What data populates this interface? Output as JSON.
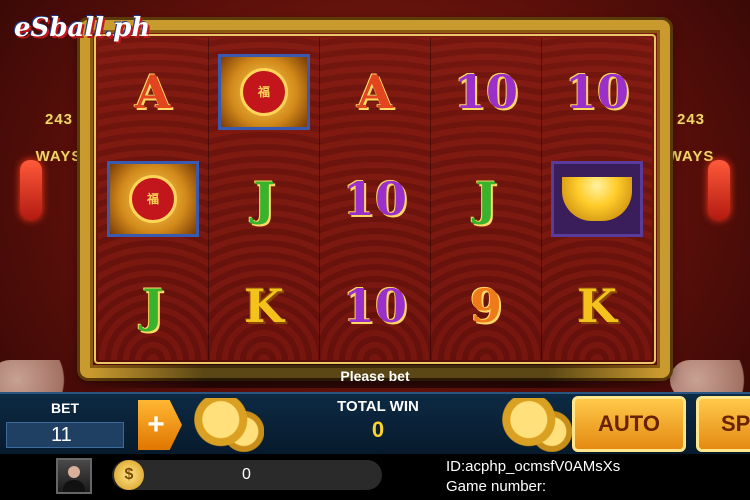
{
  "logo": {
    "text": "eSball.ph"
  },
  "side_banner": {
    "left_text": "243\nWAYS",
    "right_text": "243\nWAYS"
  },
  "reels": [
    [
      {
        "type": "text",
        "symbol": "A",
        "cls": "sym-A"
      },
      {
        "type": "fu",
        "symbol": "福"
      },
      {
        "type": "text",
        "symbol": "J",
        "cls": "sym-J"
      }
    ],
    [
      {
        "type": "fu",
        "symbol": "福"
      },
      {
        "type": "text",
        "symbol": "J",
        "cls": "sym-J"
      },
      {
        "type": "text",
        "symbol": "K",
        "cls": "sym-K"
      }
    ],
    [
      {
        "type": "text",
        "symbol": "A",
        "cls": "sym-A"
      },
      {
        "type": "text",
        "symbol": "10",
        "cls": "sym-10"
      },
      {
        "type": "text",
        "symbol": "10",
        "cls": "sym-10"
      }
    ],
    [
      {
        "type": "text",
        "symbol": "10",
        "cls": "sym-10"
      },
      {
        "type": "text",
        "symbol": "J",
        "cls": "sym-J"
      },
      {
        "type": "text",
        "symbol": "9",
        "cls": "sym-Q"
      }
    ],
    [
      {
        "type": "text",
        "symbol": "10",
        "cls": "sym-10"
      },
      {
        "type": "ingot",
        "symbol": "gold-ingot"
      },
      {
        "type": "text",
        "symbol": "K",
        "cls": "sym-K"
      }
    ]
  ],
  "status": {
    "message": "Please bet"
  },
  "controls": {
    "bet_label": "BET",
    "bet_value": "11",
    "plus_label": "+",
    "total_win_label": "TOTAL WIN",
    "total_win_value": "0",
    "auto_label": "AUTO",
    "spin_label": "SP"
  },
  "player": {
    "balance": "0",
    "coin_symbol": "$",
    "id_text": "ID:acphp_ocmsfV0AMsXs",
    "game_number_label": "Game number:"
  }
}
